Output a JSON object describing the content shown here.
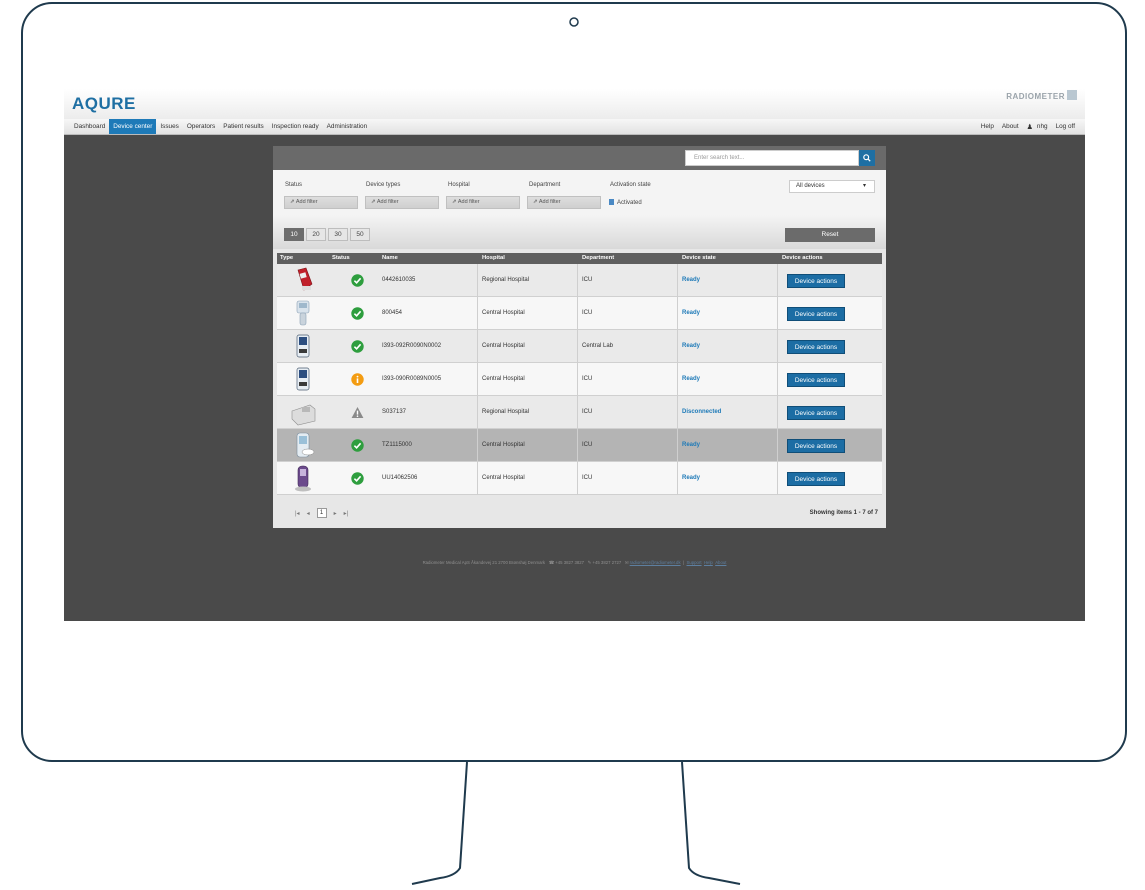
{
  "app": {
    "logo": "AQURE",
    "brand": "RADIOMETER"
  },
  "nav": {
    "items": [
      "Dashboard",
      "Device center",
      "Issues",
      "Operators",
      "Patient results",
      "Inspection ready",
      "Administration"
    ],
    "active": "Device center",
    "right": {
      "help": "Help",
      "about": "About",
      "user": "nhg",
      "logoff": "Log off"
    }
  },
  "search": {
    "placeholder": "Enter search text..."
  },
  "filters": {
    "status": {
      "label": "Status",
      "button": "Add filter"
    },
    "device_types": {
      "label": "Device types",
      "button": "Add filter"
    },
    "hospital": {
      "label": "Hospital",
      "button": "Add filter"
    },
    "department": {
      "label": "Department",
      "button": "Add filter"
    },
    "activation": {
      "label": "Activation state",
      "value": "Activated"
    },
    "devices_select": "All devices"
  },
  "page_sizes": [
    "10",
    "20",
    "30",
    "50"
  ],
  "reset_label": "Reset",
  "table": {
    "headers": [
      "Type",
      "Status",
      "Name",
      "Hospital",
      "Department",
      "Device state",
      "Device actions"
    ],
    "rows": [
      {
        "type": "blood gas handheld red",
        "status": "ok",
        "name": "0442610035",
        "hospital": "Regional Hospital",
        "department": "ICU",
        "state": "Ready",
        "action": "Device actions"
      },
      {
        "type": "handheld scanner",
        "status": "ok",
        "name": "800454",
        "hospital": "Central Hospital",
        "department": "ICU",
        "state": "Ready",
        "action": "Device actions"
      },
      {
        "type": "analyzer",
        "status": "ok",
        "name": "I393-092R0090N0002",
        "hospital": "Central Hospital",
        "department": "Central Lab",
        "state": "Ready",
        "action": "Device actions"
      },
      {
        "type": "analyzer",
        "status": "info",
        "name": "I393-090R0089N0005",
        "hospital": "Central Hospital",
        "department": "ICU",
        "state": "Ready",
        "action": "Device actions"
      },
      {
        "type": "benchtop analyzer",
        "status": "warning",
        "name": "S037137",
        "hospital": "Regional Hospital",
        "department": "ICU",
        "state": "Disconnected",
        "action": "Device actions"
      },
      {
        "type": "meter",
        "status": "ok",
        "name": "TZ1115000",
        "hospital": "Central Hospital",
        "department": "ICU",
        "state": "Ready",
        "action": "Device actions"
      },
      {
        "type": "glucose meter",
        "status": "ok",
        "name": "UU14062506",
        "hospital": "Central Hospital",
        "department": "ICU",
        "state": "Ready",
        "action": "Device actions"
      }
    ]
  },
  "pagination": {
    "current": "1",
    "showing": "Showing items 1 - 7 of 7"
  },
  "footer": {
    "company": "Radiometer Medical ApS   Åkandevej 21   2700 Brønshøj   Denmark",
    "tel": "+45 3827 3827",
    "fax": "+45 3827 2727",
    "email": "radiometer@radiometer.dk",
    "links": [
      "Support",
      "Help",
      "About"
    ]
  },
  "colors": {
    "accent": "#1e7ab8",
    "ok": "#2e9e3e",
    "info": "#f39c12",
    "warning": "#8a8a8a"
  }
}
